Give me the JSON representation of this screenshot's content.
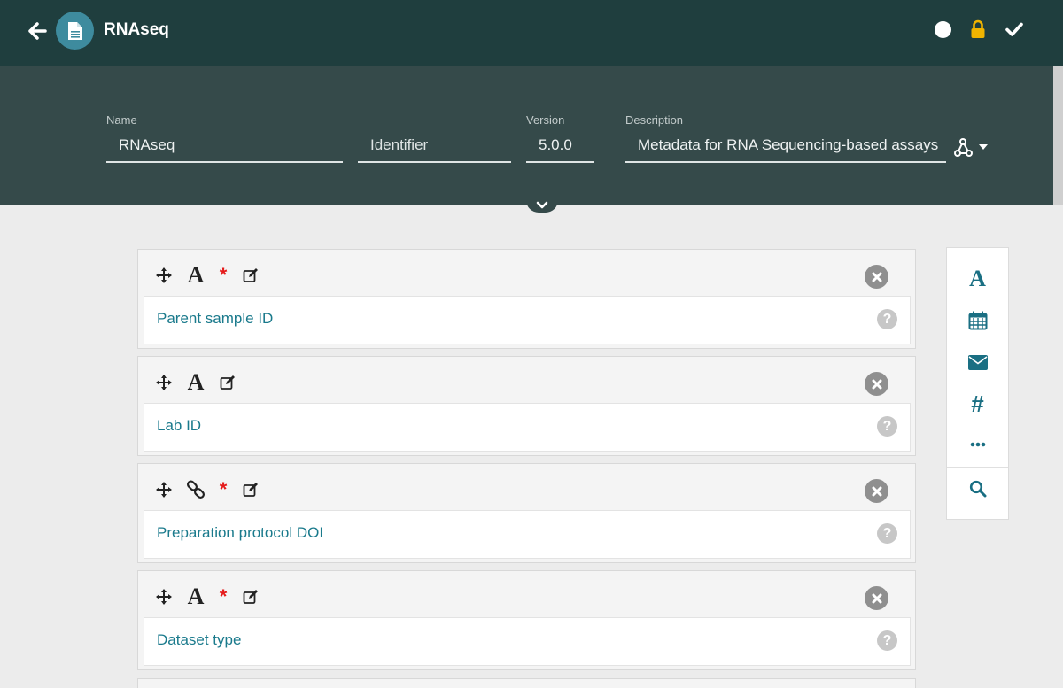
{
  "app": {
    "title": "RNAseq"
  },
  "topbar": {
    "icons": [
      "arrow-left-icon",
      "document-icon",
      "status-dot-icon",
      "lock-icon",
      "check-icon"
    ],
    "lock_color": "#f0b400"
  },
  "header": {
    "name_label": "Name",
    "name_value": "RNAseq",
    "identifier_placeholder": "Identifier",
    "version_label": "Version",
    "version_value": "5.0.0",
    "description_label": "Description",
    "description_value": "Metadata for RNA Sequencing-based assays"
  },
  "fields": [
    {
      "name": "Parent sample ID",
      "type_icon": "text-icon",
      "required": true
    },
    {
      "name": "Lab ID",
      "type_icon": "text-icon",
      "required": false
    },
    {
      "name": "Preparation protocol DOI",
      "type_icon": "link-icon",
      "required": true
    },
    {
      "name": "Dataset type",
      "type_icon": "text-icon",
      "required": true
    }
  ],
  "field_card": {
    "type_text_glyph": "A",
    "required_glyph": "*",
    "help_glyph": "?"
  },
  "palette": {
    "items": [
      "text-field-icon",
      "calendar-icon",
      "email-icon",
      "numeric-icon",
      "more-icon",
      "search-icon"
    ],
    "text_glyph": "A",
    "numeric_glyph": "#"
  },
  "colors": {
    "topbar_bg": "#1f3e3e",
    "header_bg": "#354a4a",
    "accent": "#1a7a8c",
    "required": "#e51b1b"
  }
}
